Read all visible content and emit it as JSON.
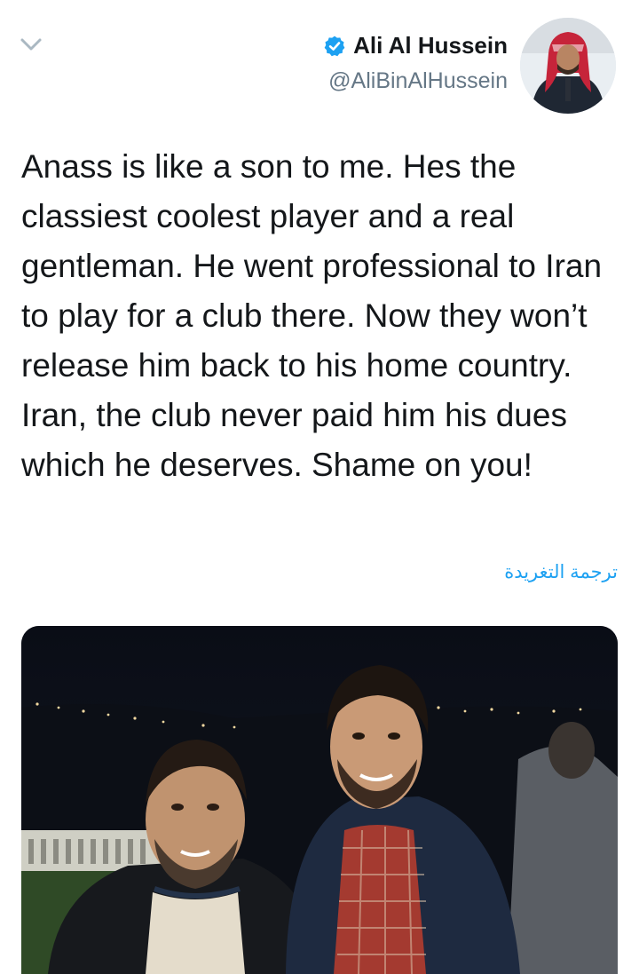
{
  "tweet": {
    "display_name": "Ali Al Hussein",
    "handle": "@AliBinAlHussein",
    "text": "Anass is like a son to me. Hes the classiest coolest player and a real gentleman. He went professional to Iran to play for a club there. Now they won’t release him back to his home country. Iran, the club never paid him his dues which he deserves. Shame on you!",
    "translate_label": "ترجمة التغريدة",
    "verified": true
  },
  "icons": {
    "menu": "chevron-down-icon",
    "verified": "verified-badge-icon"
  },
  "colors": {
    "accent": "#1da1f2",
    "text": "#14171a",
    "secondary": "#657786"
  }
}
